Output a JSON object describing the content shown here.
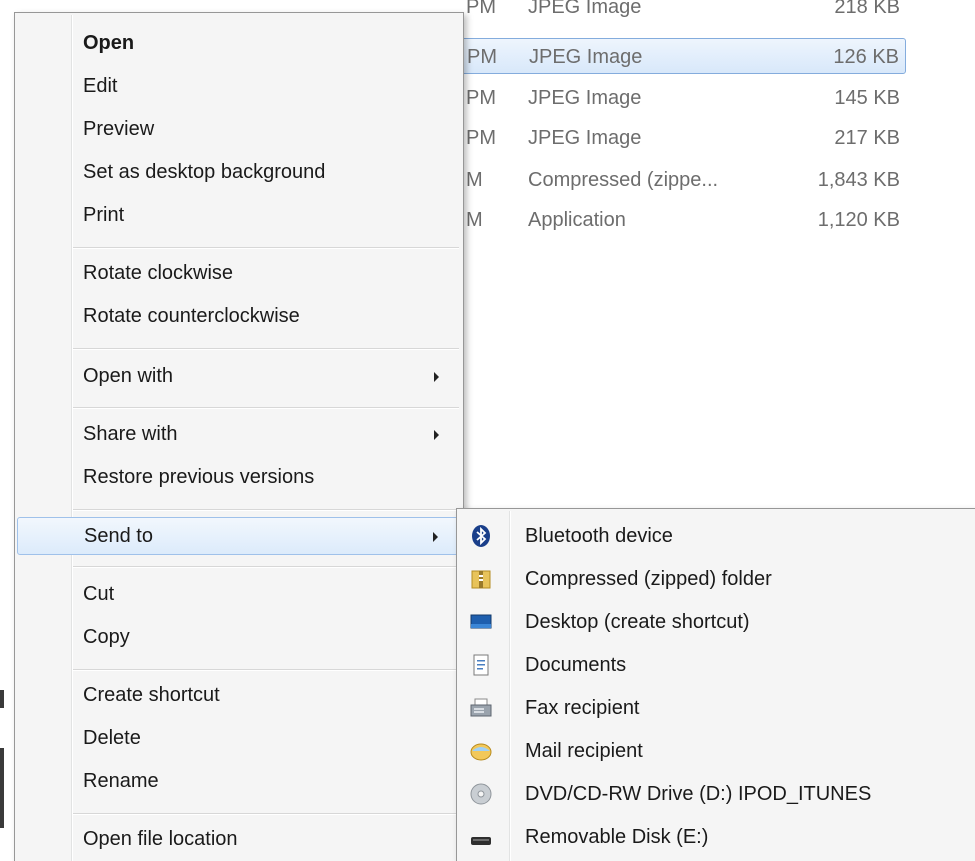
{
  "file_list": {
    "rows": [
      {
        "time": "PM",
        "type": "JPEG Image",
        "size": "218 KB",
        "partial": true
      },
      {
        "time": "PM",
        "type": "JPEG Image",
        "size": "126 KB",
        "selected": true
      },
      {
        "time": "PM",
        "type": "JPEG Image",
        "size": "145 KB"
      },
      {
        "time": "PM",
        "type": "JPEG Image",
        "size": "217 KB"
      },
      {
        "time": "M",
        "type": "Compressed (zippe...",
        "size": "1,843 KB"
      },
      {
        "time": "M",
        "type": "Application",
        "size": "1,120 KB"
      }
    ]
  },
  "context_menu": {
    "items": [
      {
        "label": "Open",
        "bold": true
      },
      {
        "label": "Edit"
      },
      {
        "label": "Preview"
      },
      {
        "label": "Set as desktop background"
      },
      {
        "label": "Print"
      },
      {
        "label": "Rotate clockwise"
      },
      {
        "label": "Rotate counterclockwise"
      },
      {
        "label": "Open with",
        "submenu": true
      },
      {
        "label": "Share with",
        "submenu": true
      },
      {
        "label": "Restore previous versions"
      },
      {
        "label": "Send to",
        "submenu": true,
        "highlighted": true
      },
      {
        "label": "Cut"
      },
      {
        "label": "Copy"
      },
      {
        "label": "Create shortcut"
      },
      {
        "label": "Delete"
      },
      {
        "label": "Rename"
      },
      {
        "label": "Open file location"
      }
    ]
  },
  "send_to_menu": {
    "items": [
      {
        "label": "Bluetooth device",
        "icon": "bluetooth-icon"
      },
      {
        "label": "Compressed (zipped) folder",
        "icon": "zip-folder-icon"
      },
      {
        "label": "Desktop (create shortcut)",
        "icon": "desktop-icon"
      },
      {
        "label": "Documents",
        "icon": "documents-icon"
      },
      {
        "label": "Fax recipient",
        "icon": "fax-icon"
      },
      {
        "label": "Mail recipient",
        "icon": "mail-icon"
      },
      {
        "label": "DVD/CD-RW Drive (D:) IPOD_ITUNES",
        "icon": "dvd-drive-icon"
      },
      {
        "label": "Removable Disk (E:)",
        "icon": "removable-disk-icon"
      }
    ]
  },
  "colors": {
    "menu_background": "#f5f5f5",
    "highlight_border": "#9fc1ea",
    "selection_border": "#84acdd",
    "muted_text": "#6d6d6d"
  }
}
